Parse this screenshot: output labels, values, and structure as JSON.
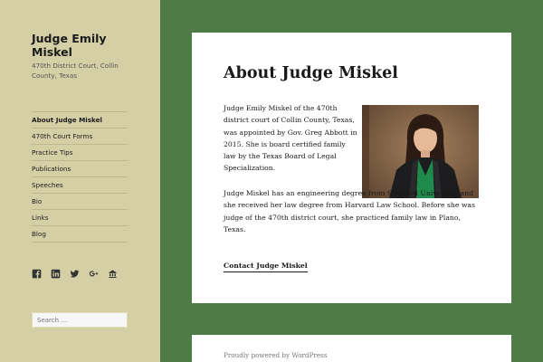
{
  "site": {
    "title": "Judge Emily Miskel",
    "description": "470th District Court, Collin County, Texas"
  },
  "menu": [
    {
      "label": "About Judge Miskel",
      "current": true
    },
    {
      "label": "470th Court Forms"
    },
    {
      "label": "Practice Tips"
    },
    {
      "label": "Publications"
    },
    {
      "label": "Speeches"
    },
    {
      "label": "Bio"
    },
    {
      "label": "Links"
    },
    {
      "label": "Blog"
    }
  ],
  "social_icons": [
    "facebook-icon",
    "linkedin-icon",
    "twitter-icon",
    "google-plus-icon",
    "rss-icon"
  ],
  "search": {
    "placeholder": "Search …"
  },
  "article": {
    "title": "About Judge Miskel",
    "paragraph1": "Judge Emily Miskel of the 470th district court of Collin County, Texas, was appointed by Gov. Greg Abbott in 2015.  She is board certified family law by the Texas Board of Legal Specialization.",
    "paragraph2": "Judge Miskel has an engineering degree from Stanford University, and she received her law degree from Harvard Law School. Before she was judge of the 470th district court, she practiced family law in Plano, Texas.",
    "contact_link": "Contact Judge Miskel"
  },
  "footer": {
    "text": "Proudly powered by WordPress"
  },
  "colors": {
    "background": "#4f7c46",
    "sidebar": "#d5cfa6",
    "card": "#ffffff"
  }
}
